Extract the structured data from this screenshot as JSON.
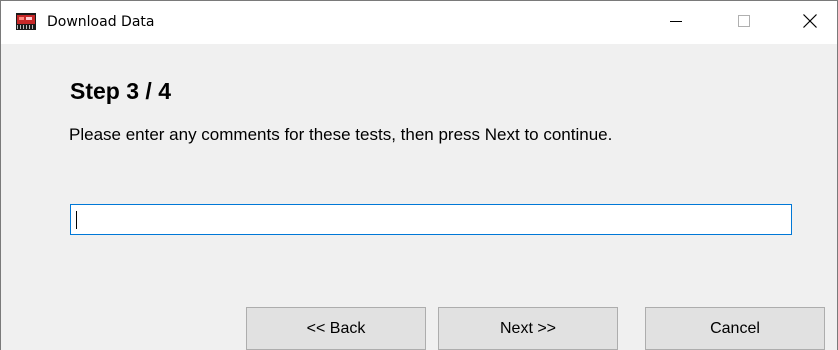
{
  "window": {
    "title": "Download Data",
    "app_icon": "red-chip-app-icon",
    "controls": {
      "minimize_icon": "minimize-icon",
      "maximize_icon": "maximize-icon",
      "close_icon": "close-icon"
    }
  },
  "wizard": {
    "step_title": "Step 3 / 4",
    "instructions": "Please enter any comments for these tests, then press Next to continue.",
    "comment_value": "",
    "comment_placeholder": ""
  },
  "buttons": {
    "back_label": "<< Back",
    "next_label": "Next >>",
    "cancel_label": "Cancel"
  },
  "colors": {
    "window_bg": "#f0f0f0",
    "titlebar_bg": "#ffffff",
    "input_focus_border": "#0078d7",
    "button_bg": "#e1e1e1",
    "button_border": "#adadad"
  }
}
